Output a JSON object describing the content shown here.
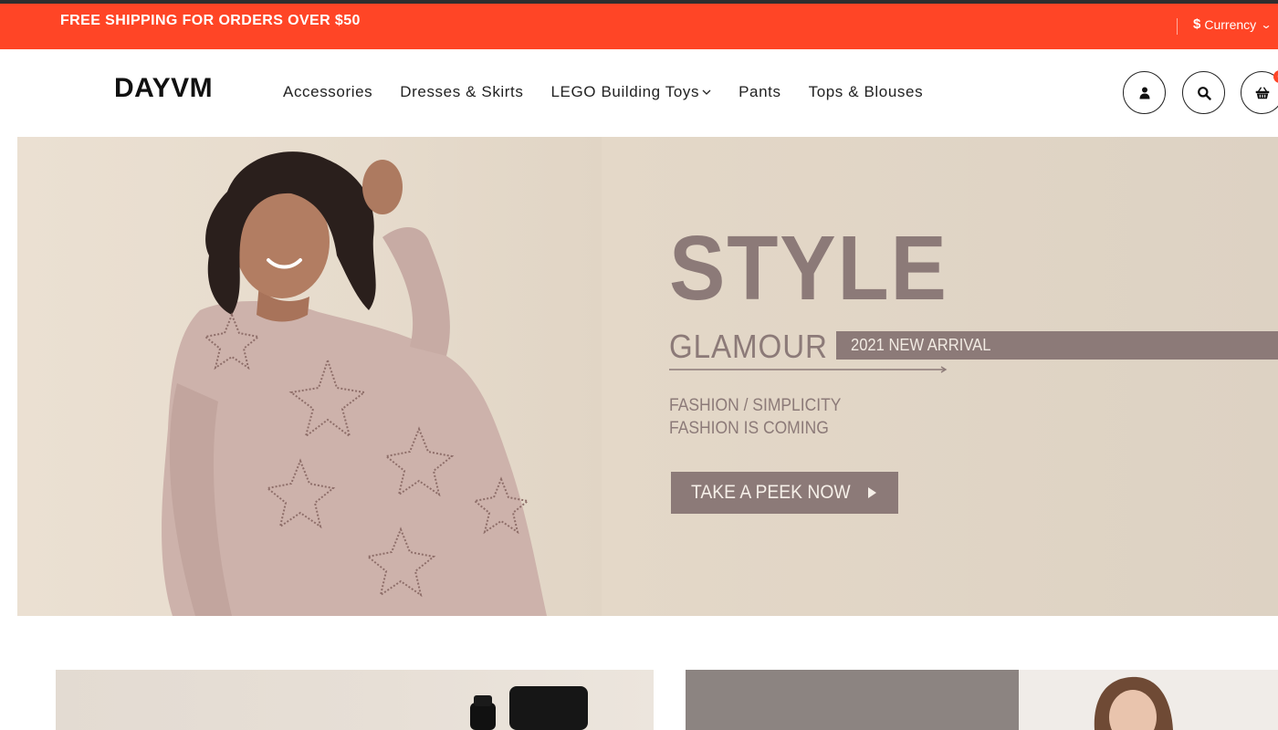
{
  "announcement": {
    "text": "FREE SHIPPING FOR ORDERS OVER $50",
    "currency_symbol": "$",
    "currency_label": "Currency",
    "background": "#ff4526"
  },
  "header": {
    "logo": "DAYVM",
    "nav": [
      {
        "label": "Accessories",
        "has_dropdown": false
      },
      {
        "label": "Dresses & Skirts",
        "has_dropdown": false
      },
      {
        "label": "LEGO Building Toys",
        "has_dropdown": true
      },
      {
        "label": "Pants",
        "has_dropdown": false
      },
      {
        "label": "Tops & Blouses",
        "has_dropdown": false
      }
    ],
    "icons": [
      "user-icon",
      "search-icon",
      "basket-icon"
    ],
    "cart_count": "0"
  },
  "hero": {
    "title": "STYLE",
    "subtitle": "GLAMOUR",
    "band_text": "2021 NEW ARRIVAL",
    "line1": "FASHION / SIMPLICITY",
    "line2": "FASHION IS COMING",
    "cta": "TAKE A PEEK NOW",
    "accent": "#8c7a78"
  }
}
